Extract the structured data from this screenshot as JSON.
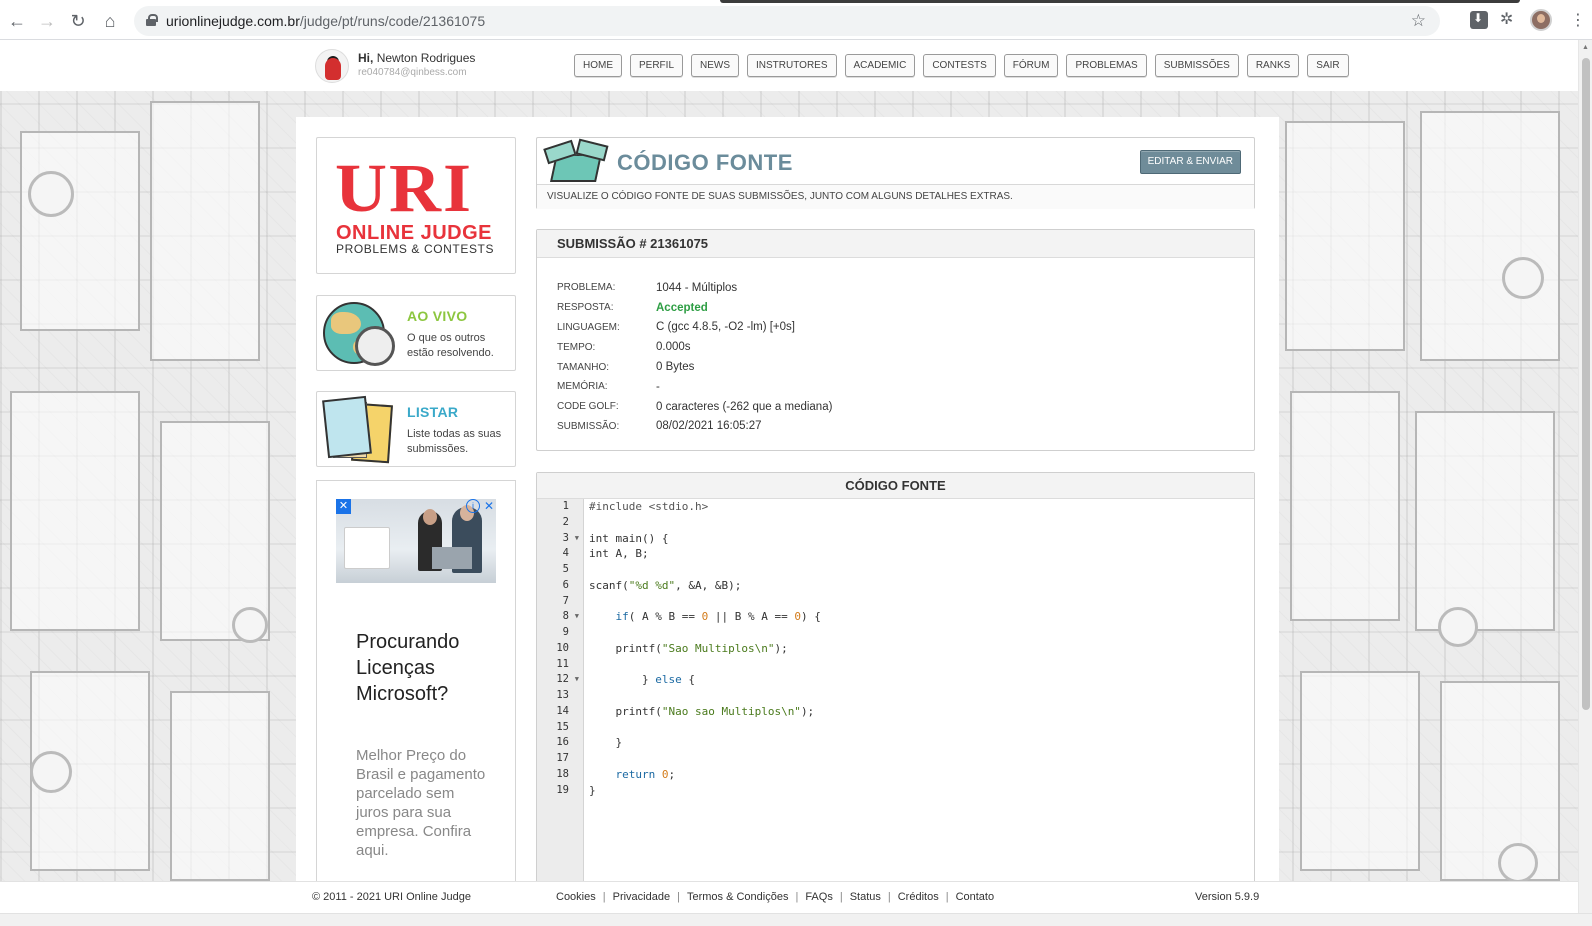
{
  "browser": {
    "url_domain": "urionlinejudge.com.br",
    "url_path": "/judge/pt/runs/code/21361075"
  },
  "header": {
    "greeting_prefix": "Hi,",
    "user_name": "Newton Rodrigues",
    "email": "re040784@qinbess.com",
    "nav": [
      "HOME",
      "PERFIL",
      "NEWS",
      "INSTRUTORES",
      "ACADEMIC",
      "CONTESTS",
      "FÓRUM",
      "PROBLEMAS",
      "SUBMISSÕES",
      "RANKS",
      "SAIR"
    ]
  },
  "logo": {
    "uri": "URI",
    "online_judge": "ONLINE JUDGE",
    "tagline": "PROBLEMS & CONTESTS"
  },
  "sidebar": {
    "live": {
      "title": "AO VIVO",
      "desc": "O que os outros estão resolvendo."
    },
    "list": {
      "title": "LISTAR",
      "desc": "Liste todas as suas submissões."
    }
  },
  "ad": {
    "headline": "Procurando Licenças Microsoft?",
    "body": "Melhor Preço do Brasil e pagamento parcelado sem juros para sua empresa. Confira aqui."
  },
  "source_panel": {
    "title": "CÓDIGO FONTE",
    "subtitle": "VISUALIZE O CÓDIGO FONTE DE SUAS SUBMISSÕES, JUNTO COM ALGUNS DETALHES EXTRAS.",
    "edit_button": "EDITAR & ENVIAR"
  },
  "submission": {
    "header": "SUBMISSÃO # 21361075",
    "rows": [
      {
        "label": "PROBLEMA:",
        "value": "1044 - Múltiplos"
      },
      {
        "label": "RESPOSTA:",
        "value": "Accepted"
      },
      {
        "label": "LINGUAGEM:",
        "value": "C (gcc 4.8.5, -O2 -lm) [+0s]"
      },
      {
        "label": "TEMPO:",
        "value": "0.000s"
      },
      {
        "label": "TAMANHO:",
        "value": "0 Bytes"
      },
      {
        "label": "MEMÓRIA:",
        "value": "-"
      },
      {
        "label": "CODE GOLF:",
        "value": "0 caracteres (-262 que a mediana)"
      },
      {
        "label": "SUBMISSÃO:",
        "value": "08/02/2021 16:05:27"
      }
    ]
  },
  "code_panel": {
    "title": "CÓDIGO FONTE",
    "lines": [
      "#include <stdio.h>",
      "",
      "int main() {",
      "int A, B;",
      "",
      "scanf(\"%d %d\", &A, &B);",
      "",
      "    if( A % B == 0 || B % A == 0) {",
      "",
      "    printf(\"Sao Multiplos\\n\");",
      "",
      "        } else {",
      "",
      "    printf(\"Nao sao Multiplos\\n\");",
      "",
      "    }",
      "",
      "    return 0;",
      "}"
    ],
    "fold_lines": [
      3,
      8,
      12
    ]
  },
  "footer": {
    "copyright": "© 2011 - 2021 URI Online Judge",
    "links": [
      "Cookies",
      "Privacidade",
      "Termos & Condições",
      "FAQs",
      "Status",
      "Créditos",
      "Contato"
    ],
    "version": "Version 5.9.9"
  }
}
